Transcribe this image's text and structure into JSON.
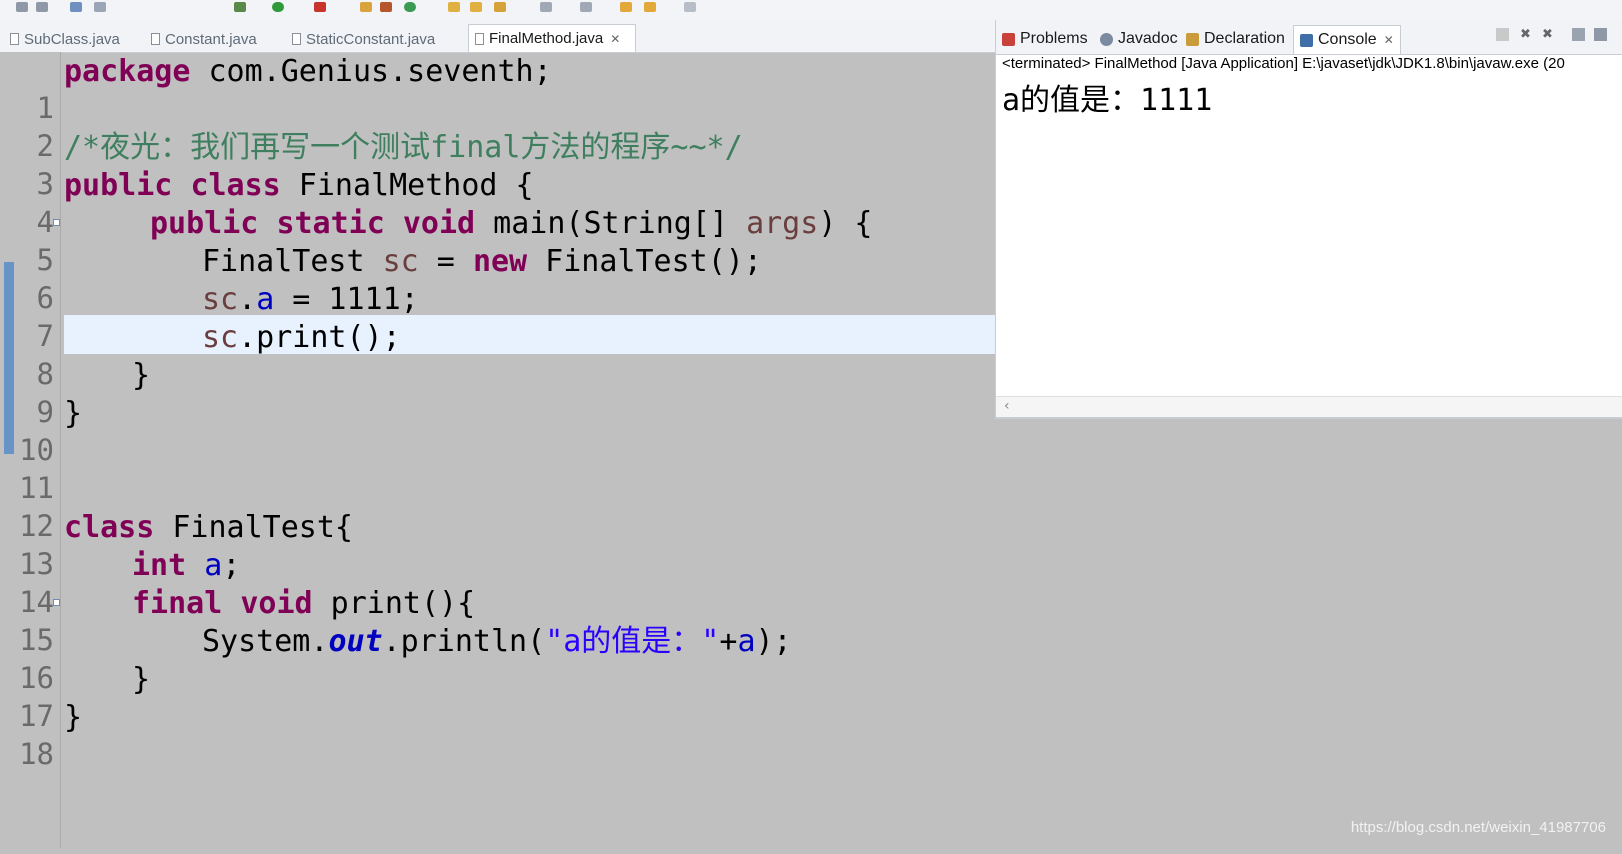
{
  "editor": {
    "tabs": [
      {
        "label": "SubClass.java"
      },
      {
        "label": "Constant.java"
      },
      {
        "label": "StaticConstant.java"
      },
      {
        "label": "FinalMethod.java",
        "close": "✕"
      }
    ],
    "lines": [
      {
        "n": "1"
      },
      {
        "n": "2"
      },
      {
        "n": "3"
      },
      {
        "n": "4"
      },
      {
        "n": "5"
      },
      {
        "n": "6"
      },
      {
        "n": "7"
      },
      {
        "n": "8"
      },
      {
        "n": "9"
      },
      {
        "n": "10"
      },
      {
        "n": "11"
      },
      {
        "n": "12"
      },
      {
        "n": "13"
      },
      {
        "n": "14"
      },
      {
        "n": "15"
      },
      {
        "n": "16"
      },
      {
        "n": "17"
      },
      {
        "n": "18"
      }
    ],
    "code": {
      "l1a": "package",
      "l1b": " com.Genius.seventh;",
      "l3": "/*夜光：我们再写一个测试final方法的程序~~*/",
      "l4a": "public",
      "l4b": "class",
      "l4c": " FinalMethod {",
      "l5a": "public",
      "l5b": "static",
      "l5c": "void",
      "l5d": " main(String[] ",
      "l5e": "args",
      "l5f": ") {",
      "l6a": "FinalTest ",
      "l6b": "sc",
      "l6c": " = ",
      "l6d": "new",
      "l6e": " FinalTest();",
      "l7a": "sc",
      "l7b": ".",
      "l7c": "a",
      "l7d": " = 1111;",
      "l8a": "sc",
      "l8b": ".print();",
      "l9": "}",
      "l10": "}",
      "l13a": "class",
      "l13b": " FinalTest{",
      "l14a": "int",
      "l14b": "a",
      "l14c": ";",
      "l15a": "final",
      "l15b": "void",
      "l15c": " print(){",
      "l16a": "System.",
      "l16b": "out",
      "l16c": ".println(",
      "l16d": "\"a的值是：\"",
      "l16e": "+",
      "l16f": "a",
      "l16g": ");",
      "l17": "}",
      "l18": "}"
    }
  },
  "console": {
    "tabs": {
      "problems": "Problems",
      "javadoc": "Javadoc",
      "declaration": "Declaration",
      "console": "Console",
      "console_close": "✕"
    },
    "status": "<terminated> FinalMethod [Java Application] E:\\javaset\\jdk\\JDK1.8\\bin\\javaw.exe (20",
    "output": "a的值是：1111"
  },
  "watermark": "https://blog.csdn.net/weixin_41987706",
  "colors": {
    "keyword": "#7f0055",
    "comment": "#3f7f5f",
    "field": "#0000c0",
    "string": "#2a00ff",
    "current_line": "#e8f2fe"
  }
}
